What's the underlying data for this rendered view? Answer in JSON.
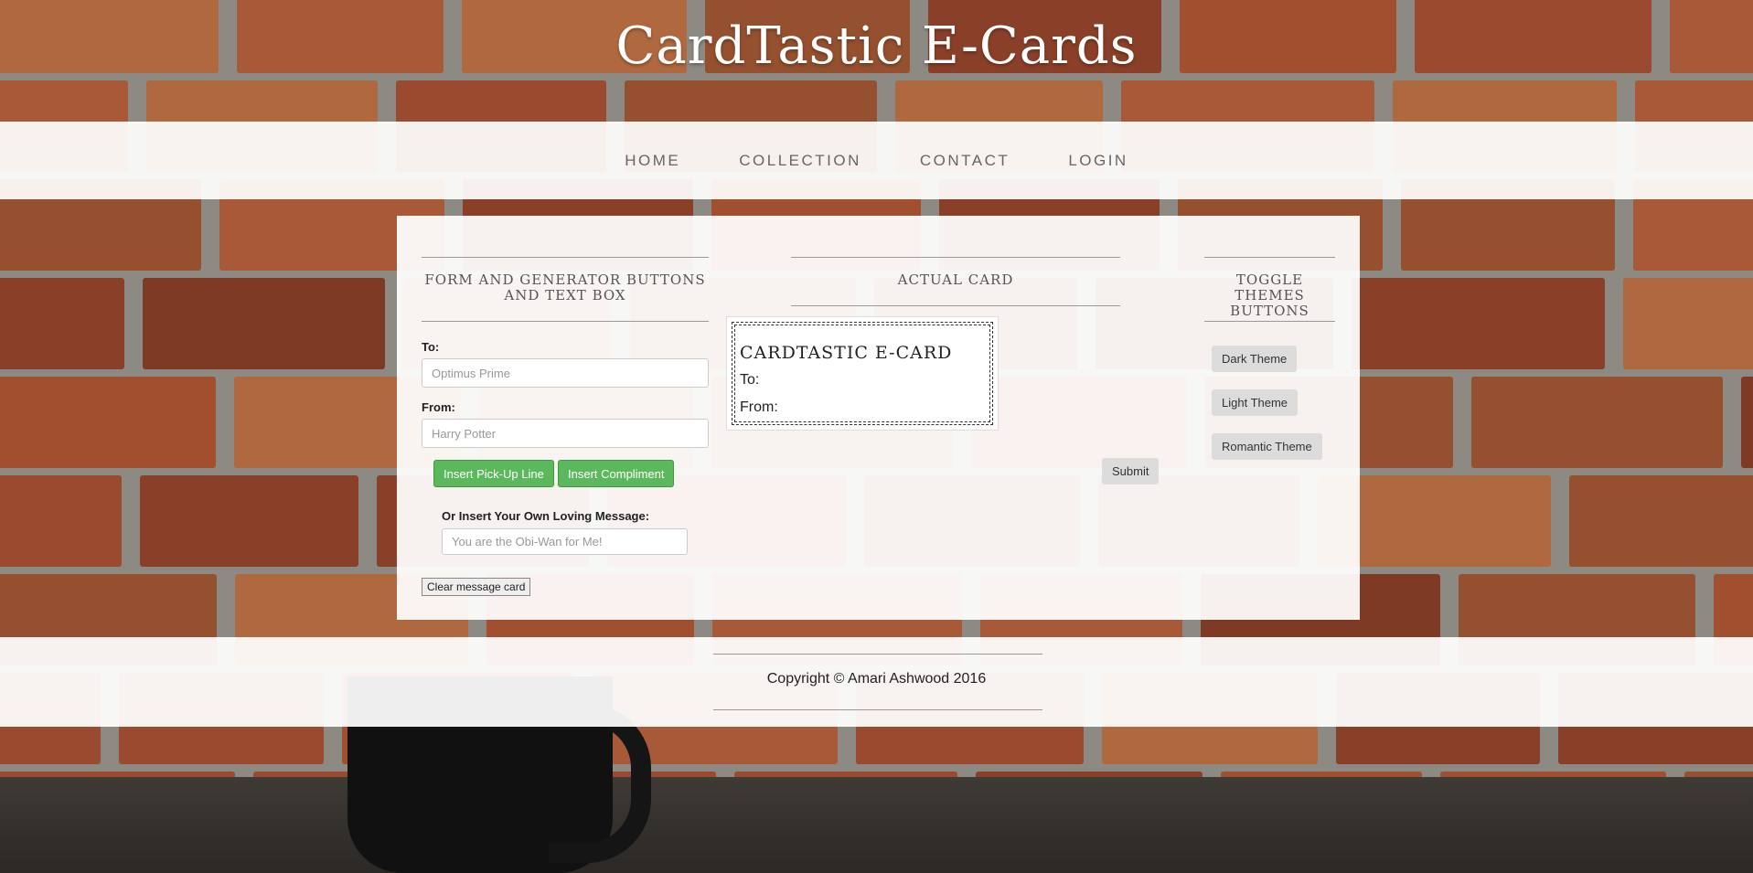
{
  "site": {
    "title": "CardTastic E-Cards"
  },
  "nav": {
    "items": [
      "HOME",
      "COLLECTION",
      "CONTACT",
      "LOGIN"
    ]
  },
  "form_column": {
    "heading": "FORM AND GENERATOR BUTTONS AND TEXT BOX",
    "to_label": "To:",
    "to_placeholder": "Optimus Prime",
    "from_label": "From:",
    "from_placeholder": "Harry Potter",
    "pickup_button": "Insert Pick-Up Line",
    "compliment_button": "Insert Compliment",
    "message_label": "Or Insert Your Own Loving Message:",
    "message_placeholder": "You are the Obi-Wan for Me!",
    "clear_button": "Clear message card"
  },
  "card_column": {
    "heading": "ACTUAL CARD",
    "card_title": "CARDTASTIC E-CARD",
    "to_line": "To:",
    "from_line": "From:",
    "submit_button": "Submit"
  },
  "themes_column": {
    "heading": "TOGGLE THEMES BUTTONS",
    "dark_button": "Dark Theme",
    "light_button": "Light Theme",
    "romantic_button": "Romantic Theme"
  },
  "footer": {
    "text": "Copyright © Amari Ashwood 2016"
  },
  "colors": {
    "green": "#5cb85c",
    "panel": "#ffffff",
    "brick": "#9a4a2e"
  }
}
